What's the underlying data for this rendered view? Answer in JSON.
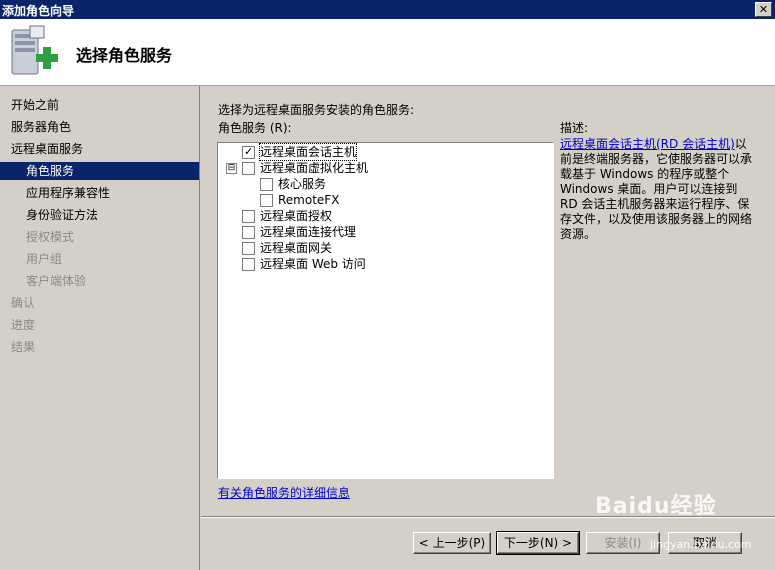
{
  "window": {
    "title": "添加角色向导",
    "close_label": "✕"
  },
  "header": {
    "title": "选择角色服务"
  },
  "nav": [
    {
      "label": "开始之前",
      "state": "normal",
      "indent": 0
    },
    {
      "label": "服务器角色",
      "state": "normal",
      "indent": 0
    },
    {
      "label": "远程桌面服务",
      "state": "normal",
      "indent": 0
    },
    {
      "label": "角色服务",
      "state": "selected",
      "indent": 1
    },
    {
      "label": "应用程序兼容性",
      "state": "normal",
      "indent": 1
    },
    {
      "label": "身份验证方法",
      "state": "normal",
      "indent": 1
    },
    {
      "label": "授权模式",
      "state": "dim",
      "indent": 1
    },
    {
      "label": "用户组",
      "state": "dim",
      "indent": 1
    },
    {
      "label": "客户端体验",
      "state": "dim",
      "indent": 1
    },
    {
      "label": "确认",
      "state": "dim",
      "indent": 0
    },
    {
      "label": "进度",
      "state": "dim",
      "indent": 0
    },
    {
      "label": "结果",
      "state": "dim",
      "indent": 0
    }
  ],
  "main": {
    "instruction": "选择为远程桌面服务安装的角色服务:",
    "list_label": "角色服务 (R):",
    "services": [
      {
        "label": "远程桌面会话主机",
        "checked": true,
        "level": 0,
        "expander": "",
        "selected": true
      },
      {
        "label": "远程桌面虚拟化主机",
        "checked": false,
        "level": 0,
        "expander": "⊟",
        "selected": false
      },
      {
        "label": "核心服务",
        "checked": false,
        "level": 1,
        "expander": "",
        "selected": false
      },
      {
        "label": "RemoteFX",
        "checked": false,
        "level": 1,
        "expander": "",
        "selected": false
      },
      {
        "label": "远程桌面授权",
        "checked": false,
        "level": 0,
        "expander": "",
        "selected": false
      },
      {
        "label": "远程桌面连接代理",
        "checked": false,
        "level": 0,
        "expander": "",
        "selected": false
      },
      {
        "label": "远程桌面网关",
        "checked": false,
        "level": 0,
        "expander": "",
        "selected": false
      },
      {
        "label": "远程桌面 Web 访问",
        "checked": false,
        "level": 0,
        "expander": "",
        "selected": false
      }
    ],
    "more_info_link": "有关角色服务的详细信息",
    "description_title": "描述:",
    "description_link": "远程桌面会话主机(RD 会话主机)",
    "description_text": "以前是终端服务器，它使服务器可以承载基于 Windows 的程序或整个 Windows 桌面。用户可以连接到 RD 会话主机服务器来运行程序、保存文件，以及使用该服务器上的网络资源。"
  },
  "buttons": {
    "back": "< 上一步(P)",
    "next": "下一步(N) >",
    "install": "安装(I)",
    "cancel": "取消"
  },
  "watermark": {
    "brand": "Baidu经验",
    "url": "jingyan.baidu.com"
  },
  "colors": {
    "titlebar": "#0a246a",
    "selection": "#0a246a",
    "face": "#d4d0c8",
    "link": "#0000cc"
  }
}
